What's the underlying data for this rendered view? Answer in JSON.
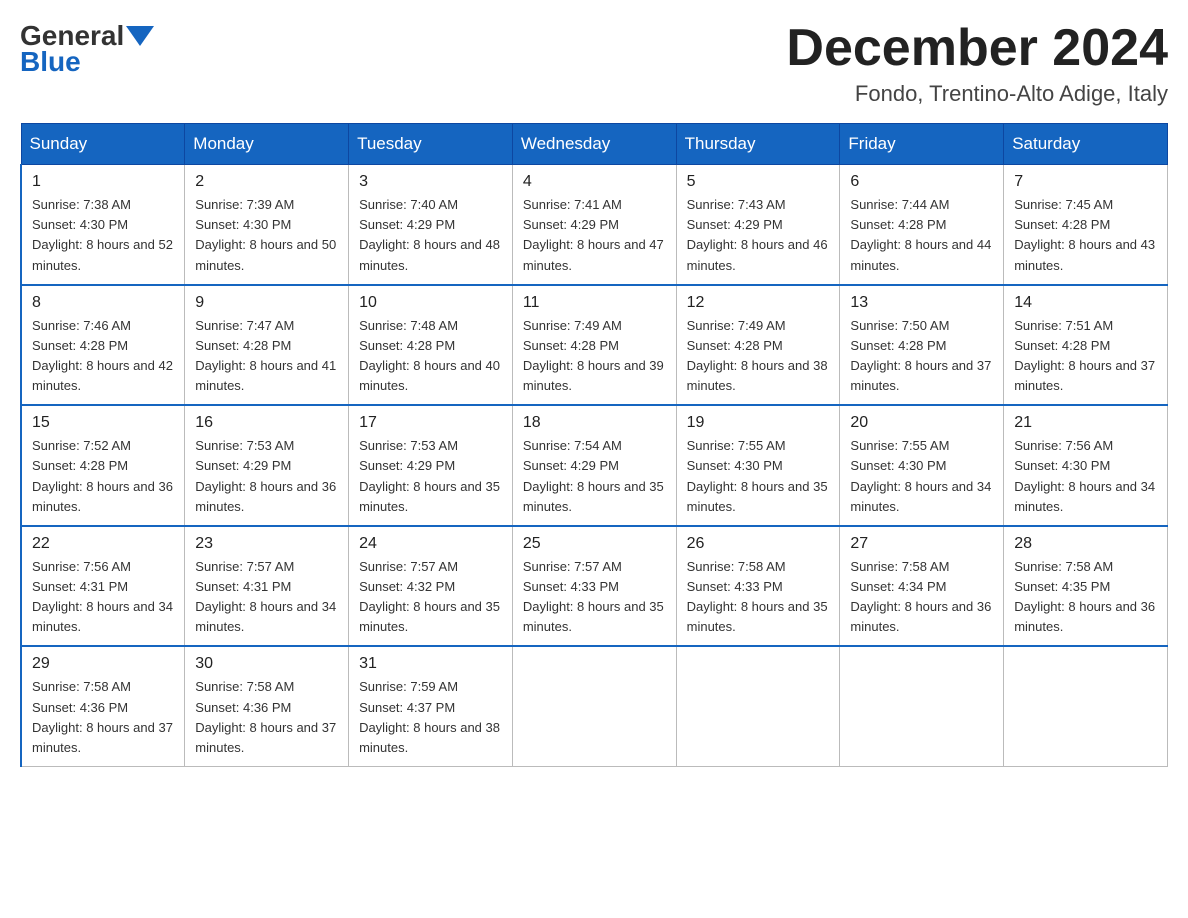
{
  "logo": {
    "general": "General",
    "blue": "Blue"
  },
  "header": {
    "month": "December 2024",
    "location": "Fondo, Trentino-Alto Adige, Italy"
  },
  "weekdays": [
    "Sunday",
    "Monday",
    "Tuesday",
    "Wednesday",
    "Thursday",
    "Friday",
    "Saturday"
  ],
  "weeks": [
    [
      {
        "day": "1",
        "sunrise": "7:38 AM",
        "sunset": "4:30 PM",
        "daylight": "8 hours and 52 minutes."
      },
      {
        "day": "2",
        "sunrise": "7:39 AM",
        "sunset": "4:30 PM",
        "daylight": "8 hours and 50 minutes."
      },
      {
        "day": "3",
        "sunrise": "7:40 AM",
        "sunset": "4:29 PM",
        "daylight": "8 hours and 48 minutes."
      },
      {
        "day": "4",
        "sunrise": "7:41 AM",
        "sunset": "4:29 PM",
        "daylight": "8 hours and 47 minutes."
      },
      {
        "day": "5",
        "sunrise": "7:43 AM",
        "sunset": "4:29 PM",
        "daylight": "8 hours and 46 minutes."
      },
      {
        "day": "6",
        "sunrise": "7:44 AM",
        "sunset": "4:28 PM",
        "daylight": "8 hours and 44 minutes."
      },
      {
        "day": "7",
        "sunrise": "7:45 AM",
        "sunset": "4:28 PM",
        "daylight": "8 hours and 43 minutes."
      }
    ],
    [
      {
        "day": "8",
        "sunrise": "7:46 AM",
        "sunset": "4:28 PM",
        "daylight": "8 hours and 42 minutes."
      },
      {
        "day": "9",
        "sunrise": "7:47 AM",
        "sunset": "4:28 PM",
        "daylight": "8 hours and 41 minutes."
      },
      {
        "day": "10",
        "sunrise": "7:48 AM",
        "sunset": "4:28 PM",
        "daylight": "8 hours and 40 minutes."
      },
      {
        "day": "11",
        "sunrise": "7:49 AM",
        "sunset": "4:28 PM",
        "daylight": "8 hours and 39 minutes."
      },
      {
        "day": "12",
        "sunrise": "7:49 AM",
        "sunset": "4:28 PM",
        "daylight": "8 hours and 38 minutes."
      },
      {
        "day": "13",
        "sunrise": "7:50 AM",
        "sunset": "4:28 PM",
        "daylight": "8 hours and 37 minutes."
      },
      {
        "day": "14",
        "sunrise": "7:51 AM",
        "sunset": "4:28 PM",
        "daylight": "8 hours and 37 minutes."
      }
    ],
    [
      {
        "day": "15",
        "sunrise": "7:52 AM",
        "sunset": "4:28 PM",
        "daylight": "8 hours and 36 minutes."
      },
      {
        "day": "16",
        "sunrise": "7:53 AM",
        "sunset": "4:29 PM",
        "daylight": "8 hours and 36 minutes."
      },
      {
        "day": "17",
        "sunrise": "7:53 AM",
        "sunset": "4:29 PM",
        "daylight": "8 hours and 35 minutes."
      },
      {
        "day": "18",
        "sunrise": "7:54 AM",
        "sunset": "4:29 PM",
        "daylight": "8 hours and 35 minutes."
      },
      {
        "day": "19",
        "sunrise": "7:55 AM",
        "sunset": "4:30 PM",
        "daylight": "8 hours and 35 minutes."
      },
      {
        "day": "20",
        "sunrise": "7:55 AM",
        "sunset": "4:30 PM",
        "daylight": "8 hours and 34 minutes."
      },
      {
        "day": "21",
        "sunrise": "7:56 AM",
        "sunset": "4:30 PM",
        "daylight": "8 hours and 34 minutes."
      }
    ],
    [
      {
        "day": "22",
        "sunrise": "7:56 AM",
        "sunset": "4:31 PM",
        "daylight": "8 hours and 34 minutes."
      },
      {
        "day": "23",
        "sunrise": "7:57 AM",
        "sunset": "4:31 PM",
        "daylight": "8 hours and 34 minutes."
      },
      {
        "day": "24",
        "sunrise": "7:57 AM",
        "sunset": "4:32 PM",
        "daylight": "8 hours and 35 minutes."
      },
      {
        "day": "25",
        "sunrise": "7:57 AM",
        "sunset": "4:33 PM",
        "daylight": "8 hours and 35 minutes."
      },
      {
        "day": "26",
        "sunrise": "7:58 AM",
        "sunset": "4:33 PM",
        "daylight": "8 hours and 35 minutes."
      },
      {
        "day": "27",
        "sunrise": "7:58 AM",
        "sunset": "4:34 PM",
        "daylight": "8 hours and 36 minutes."
      },
      {
        "day": "28",
        "sunrise": "7:58 AM",
        "sunset": "4:35 PM",
        "daylight": "8 hours and 36 minutes."
      }
    ],
    [
      {
        "day": "29",
        "sunrise": "7:58 AM",
        "sunset": "4:36 PM",
        "daylight": "8 hours and 37 minutes."
      },
      {
        "day": "30",
        "sunrise": "7:58 AM",
        "sunset": "4:36 PM",
        "daylight": "8 hours and 37 minutes."
      },
      {
        "day": "31",
        "sunrise": "7:59 AM",
        "sunset": "4:37 PM",
        "daylight": "8 hours and 38 minutes."
      },
      null,
      null,
      null,
      null
    ]
  ]
}
